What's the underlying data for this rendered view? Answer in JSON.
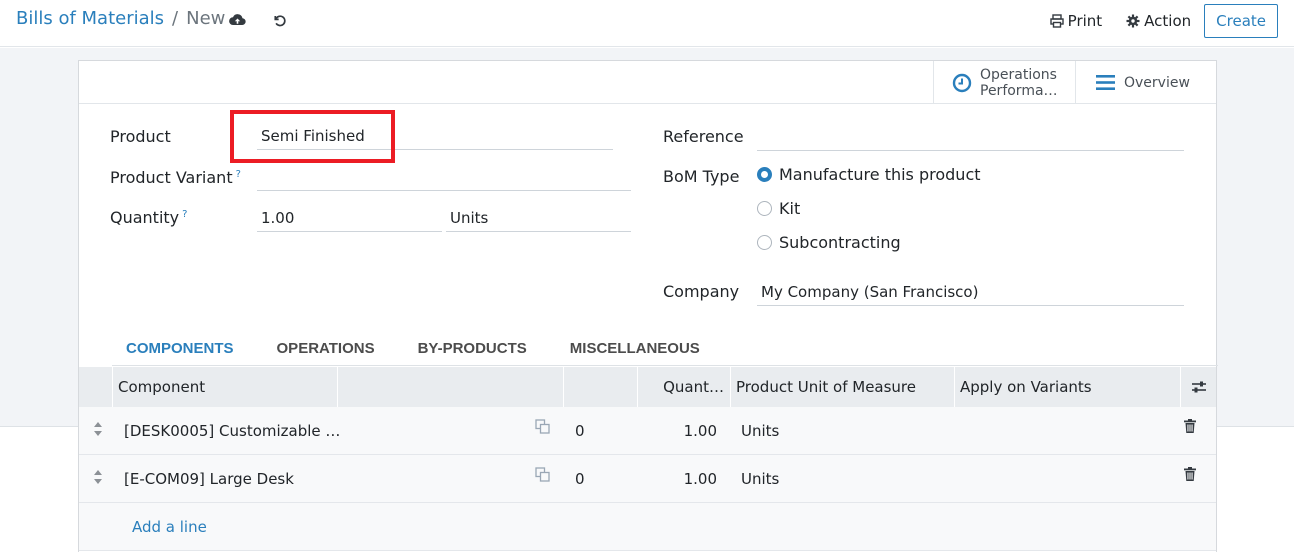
{
  "breadcrumb": {
    "parent": "Bills of Materials",
    "separator": "/",
    "current": "New"
  },
  "control_panel": {
    "print_label": "Print",
    "action_label": "Action",
    "create_label": "Create"
  },
  "smart_buttons": {
    "operations_line1": "Operations",
    "operations_line2": "Performa…",
    "overview_label": "Overview"
  },
  "form": {
    "product_label": "Product",
    "product_value": "Semi Finished",
    "variant_label": "Product Variant",
    "variant_value": "",
    "help_marker": "?",
    "quantity_label": "Quantity",
    "quantity_value": "1.00",
    "quantity_uom": "Units",
    "reference_label": "Reference",
    "reference_value": "",
    "bom_type_label": "BoM Type",
    "bom_types": [
      "Manufacture this product",
      "Kit",
      "Subcontracting"
    ],
    "bom_type_selected": "Manufacture this product",
    "company_label": "Company",
    "company_value": "My Company (San Francisco)"
  },
  "tabs": [
    "COMPONENTS",
    "OPERATIONS",
    "BY-PRODUCTS",
    "MISCELLANEOUS"
  ],
  "active_tab": "COMPONENTS",
  "table": {
    "columns": [
      "Component",
      "Quant…",
      "Product Unit of Measure",
      "Apply on Variants"
    ],
    "rows": [
      {
        "component": "[DESK0005] Customizable …",
        "col3": "0",
        "quantity": "1.00",
        "uom": "Units"
      },
      {
        "component": "[E-COM09] Large Desk",
        "col3": "0",
        "quantity": "1.00",
        "uom": "Units"
      }
    ],
    "add_line_label": "Add a line"
  },
  "colors": {
    "accent": "#2a7fbc",
    "highlight_box": "#ec1c24",
    "background": "#f2f4f7"
  }
}
